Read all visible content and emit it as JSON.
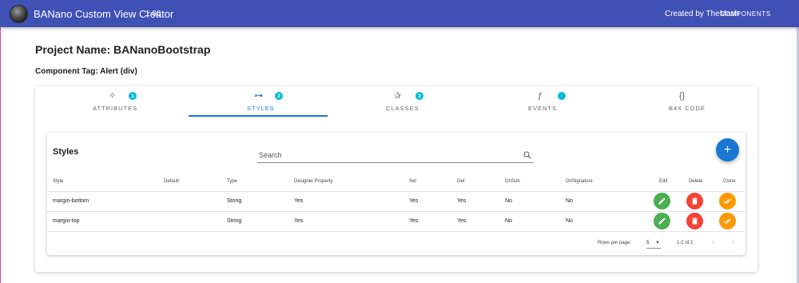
{
  "app": {
    "title": "BANano Custom View Creator",
    "version": "1.00",
    "created_by": "Created by TheMash",
    "components_label": "COMPONENTS"
  },
  "project": {
    "name": "Project Name: BANanoBootstrap",
    "component_tag": "Component Tag: Alert (div)"
  },
  "tabs": [
    {
      "label": "ATTRIBUTES",
      "icon": "gear-icon",
      "glyph": "✧",
      "badge": "1"
    },
    {
      "label": "STYLES",
      "icon": "styles-icon",
      "glyph": "⊶",
      "badge": "2",
      "active": true
    },
    {
      "label": "CLASSES",
      "icon": "classes-icon",
      "glyph": "✰",
      "badge": "2"
    },
    {
      "label": "EVENTS",
      "icon": "function-icon",
      "glyph": "ƒ",
      "badge": ""
    },
    {
      "label": "B4X CODE",
      "icon": "code-braces-icon",
      "glyph": "{}",
      "badge": ""
    }
  ],
  "styles_card": {
    "title": "Styles",
    "search_placeholder": "Search",
    "add_label": "+"
  },
  "table": {
    "columns": [
      "Style",
      "Default",
      "Type",
      "Designer Property",
      "Set",
      "Get",
      "OnSub",
      "OnSignature",
      "Edit",
      "Delete",
      "Clone"
    ],
    "rows": [
      {
        "style": "margin-bottom",
        "default": "",
        "type": "String",
        "designer": "Yes",
        "set": "Yes",
        "get": "Yes",
        "onsub": "No",
        "onsignature": "No"
      },
      {
        "style": "margin-top",
        "default": "",
        "type": "String",
        "designer": "Yes",
        "set": "Yes",
        "get": "Yes",
        "onsub": "No",
        "onsignature": "No"
      }
    ],
    "footer": {
      "rows_per_page_label": "Rows per page:",
      "rows_per_page_value": "5",
      "range": "1-2 of 2"
    }
  },
  "colors": {
    "appbar": "#3f51b5",
    "primary": "#1976d2",
    "badge": "#00bcd4",
    "edit": "#4caf50",
    "delete": "#f44336",
    "clone": "#ff9800"
  }
}
